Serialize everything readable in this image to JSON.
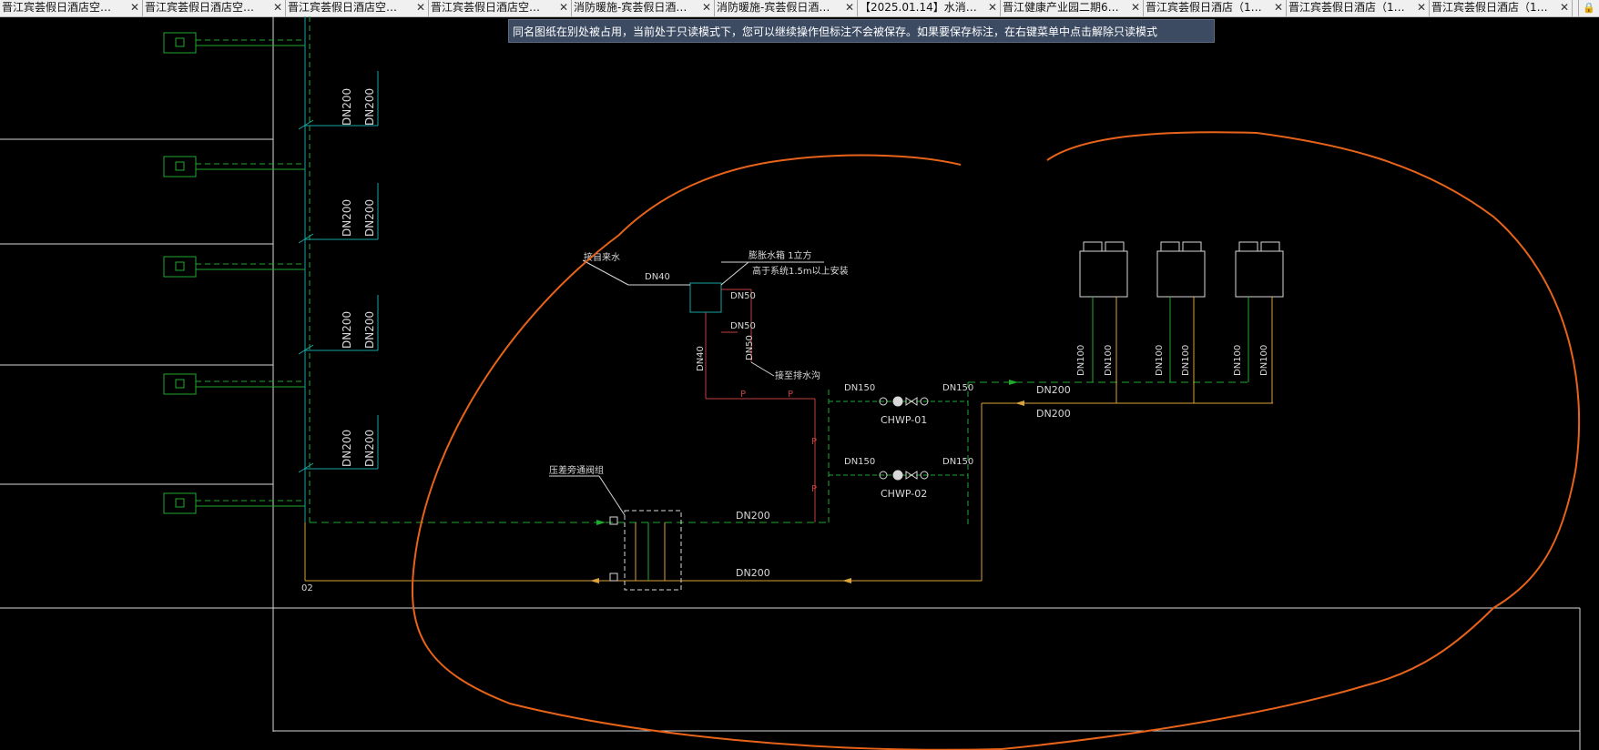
{
  "tabs": [
    {
      "label": "晋江宾荟假日酒店空…",
      "close": "✕"
    },
    {
      "label": "晋江宾荟假日酒店空…",
      "close": "✕"
    },
    {
      "label": "晋江宾荟假日酒店空…",
      "close": "✕"
    },
    {
      "label": "晋江宾荟假日酒店空…",
      "close": "✕"
    },
    {
      "label": "消防暖施-宾荟假日酒…",
      "close": "✕"
    },
    {
      "label": "消防暖施-宾荟假日酒…",
      "close": "✕"
    },
    {
      "label": "【2025.01.14】水消…",
      "close": "✕"
    },
    {
      "label": "晋江健康产业园二期6…",
      "close": "✕"
    },
    {
      "label": "晋江宾荟假日酒店（1…",
      "close": "✕"
    },
    {
      "label": "晋江宾荟假日酒店（1…",
      "close": "✕"
    },
    {
      "label": "晋江宾荟假日酒店（1…",
      "close": "✕"
    }
  ],
  "lock_icon": "lock-icon",
  "notice": "同名图纸在别处被占用，当前处于只读模式下，您可以继续操作但标注不会被保存。如果要保存标注，在右键菜单中点击解除只读模式",
  "colors": {
    "background": "#000000",
    "green": "#1faa2e",
    "cyan": "#1aa5a5",
    "orange_markup": "#e8631a",
    "supply": "#d9a23a",
    "white": "#d8d8d8",
    "red": "#c04040"
  },
  "drawing": {
    "dn200_labels": [
      "DN200",
      "DN200",
      "DN200",
      "DN200",
      "DN200",
      "DN200",
      "DN200",
      "DN200"
    ],
    "tap_water_label": "接自来水",
    "tank_label_1": "膨胀水箱 1立方",
    "tank_label_2": "高于系统1.5m以上安装",
    "dn40_a": "DN40",
    "dn40_b": "DN40",
    "dn50_a": "DN50",
    "dn50_b": "DN50",
    "dn50_c": "DN50",
    "drain_label": "接至排水沟",
    "pump_1": "CHWP-01",
    "pump_2": "CHWP-02",
    "dn150": [
      "DN150",
      "DN150",
      "DN150",
      "DN150"
    ],
    "main_supply": "DN200",
    "main_return": "DN200",
    "bottom_supply": "DN200",
    "bottom_return": "DN200",
    "bypass_label": "压差旁通阀组",
    "unit_labels": [
      "DN100",
      "DN100",
      "DN100",
      "DN100",
      "DN100",
      "DN100"
    ],
    "p_marks": [
      "P",
      "P",
      "P",
      "P"
    ],
    "corner_mark": "02"
  }
}
